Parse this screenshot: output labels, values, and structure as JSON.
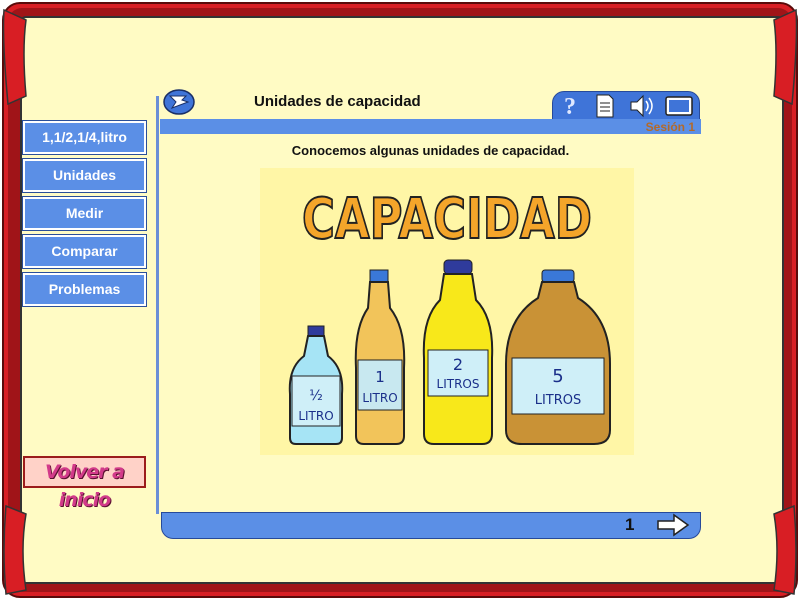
{
  "window": {
    "title": "Unidades de capacidad",
    "session": "Sesión 1"
  },
  "nav": {
    "items": [
      {
        "label": "1,1/2,1/4,litro"
      },
      {
        "label": "Unidades"
      },
      {
        "label": "Medir"
      },
      {
        "label": "Comparar"
      },
      {
        "label": "Problemas"
      }
    ],
    "home_label": "Volver a inicio"
  },
  "toolbar": {
    "icons": [
      "help-icon",
      "document-icon",
      "speaker-icon",
      "screen-icon"
    ]
  },
  "content": {
    "intro": "Conocemos algunas unidades de capacidad.",
    "illustration": {
      "heading": "CAPACIDAD",
      "bottles": [
        {
          "label_top": "½",
          "label_bottom": "LITRO"
        },
        {
          "label_top": "1",
          "label_bottom": "LITRO"
        },
        {
          "label_top": "2",
          "label_bottom": "LITROS"
        },
        {
          "label_top": "5",
          "label_bottom": "LITROS"
        }
      ]
    }
  },
  "footer": {
    "page": "1"
  },
  "colors": {
    "frame": "#d81e24",
    "paper": "#fffbc4",
    "nav_blue": "#5b8fe6",
    "heading_orange": "#f4a52a"
  }
}
